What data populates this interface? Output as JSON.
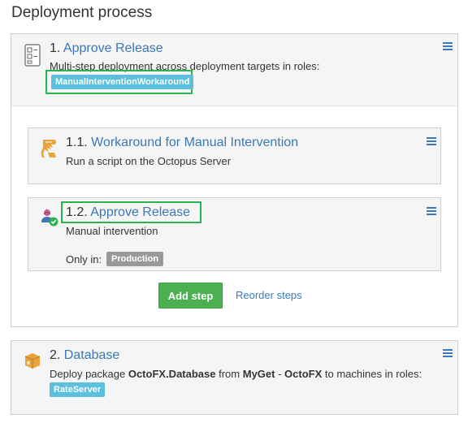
{
  "page": {
    "title": "Deployment process"
  },
  "steps": [
    {
      "number": "1.",
      "name": "Approve Release",
      "description": "Multi-step deployment across deployment targets in roles:",
      "roles": [
        "ManualInterventionWorkaround"
      ],
      "icon": "multi-step-icon",
      "children": [
        {
          "number": "1.1.",
          "name": "Workaround for Manual Intervention",
          "description": "Run a script on the Octopus Server",
          "icon": "script-icon"
        },
        {
          "number": "1.2.",
          "name": "Approve Release",
          "description": "Manual intervention",
          "only_in_label": "Only in:",
          "environments": [
            "Production"
          ],
          "icon": "user-approval-icon"
        }
      ],
      "actions": {
        "add_step": "Add step",
        "reorder_steps": "Reorder steps"
      }
    },
    {
      "number": "2.",
      "name": "Database",
      "description_parts": {
        "prefix": "Deploy package ",
        "package": "OctoFX.Database",
        "from": " from ",
        "feed": "MyGet",
        "dash": " - ",
        "project": "OctoFX",
        "suffix": " to machines in roles:"
      },
      "roles": [
        "RateServer"
      ],
      "icon": "package-icon"
    }
  ],
  "colors": {
    "link": "#3a78b8",
    "role_chip": "#5bc0de",
    "env_chip": "#999999",
    "primary_button": "#4cb050",
    "highlight_outline": "#2bb34f",
    "script_icon": "#e8a33b",
    "package_icon": "#e8a33b"
  }
}
